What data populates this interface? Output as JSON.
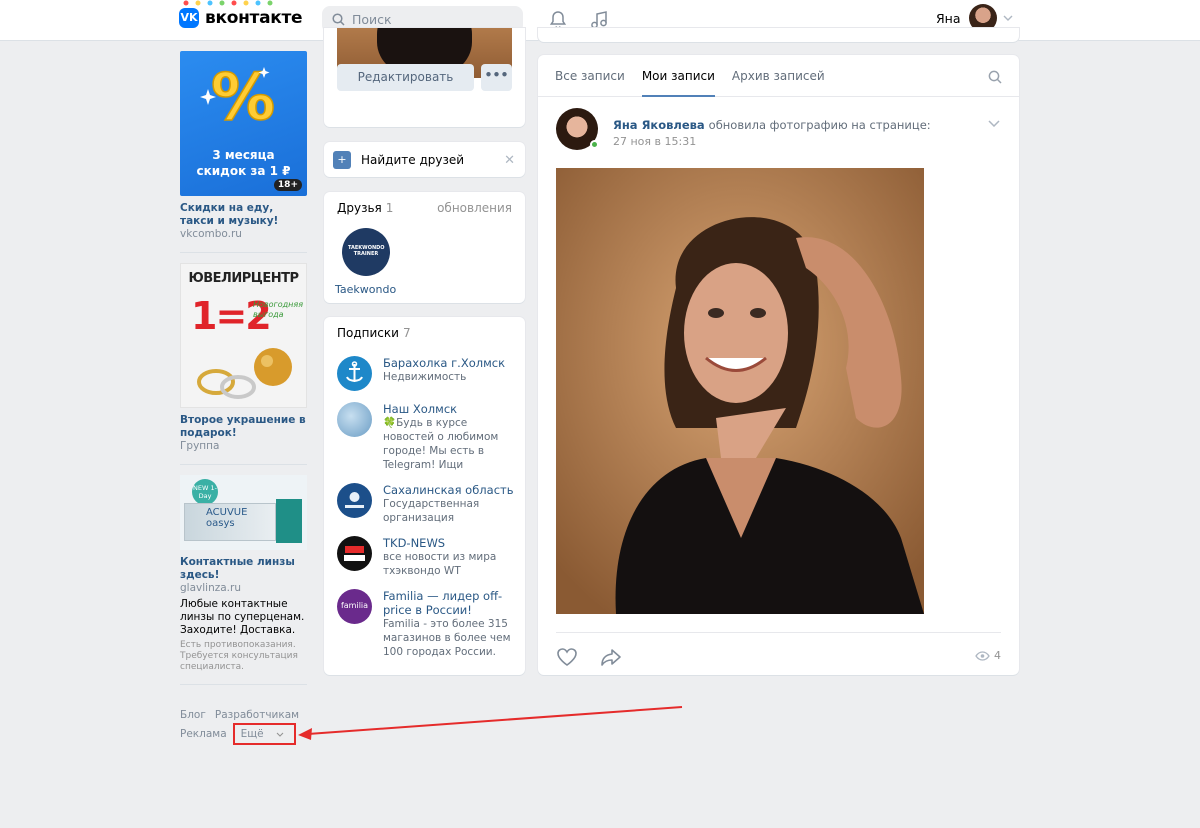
{
  "header": {
    "logo_text": "вконтакте",
    "search_placeholder": "Поиск",
    "user_name": "Яна"
  },
  "left_ads": [
    {
      "badge": "18+",
      "banner_text": "3 месяца скидок за 1 ₽",
      "title": "Скидки на еду, такси и музыку!",
      "sub": "vkcombo.ru"
    },
    {
      "banner_text_top": "ЮВЕЛИРЦЕНТР",
      "banner_text_mid": "1=2",
      "banner_text_script": "Новогодняя выгода",
      "title": "Второе украшение в подарок!",
      "sub": "Группа"
    },
    {
      "banner_text_brand": "ACUVUE oasys",
      "banner_text_badge": "NEW 1-Day",
      "title": "Контактные линзы здесь!",
      "sub": "glavlinza.ru",
      "desc": "Любые контактные линзы по суперценам. Заходите! Доставка.",
      "note": "Есть противопоказания. Требуется консультация специалиста."
    }
  ],
  "footer": {
    "links": [
      "Блог",
      "Разработчикам",
      "Реклама"
    ],
    "more": "Ещё"
  },
  "profile": {
    "edit_button": "Редактировать",
    "more_button": "•••"
  },
  "find_friends": {
    "label": "Найдите друзей"
  },
  "friends": {
    "title": "Друзья",
    "count": "1",
    "updates": "обновления",
    "items": [
      {
        "name": "Taekwondo",
        "logo_text": "TAEKWONDO TRAINER"
      }
    ]
  },
  "subscriptions": {
    "title": "Подписки",
    "count": "7",
    "items": [
      {
        "name": "Барахолка г.Холмск",
        "desc": "Недвижимость",
        "color": "#1e88c9"
      },
      {
        "name": "Наш Холмск",
        "desc": "🍀Будь в курсе новостей о любимом городе! Мы есть в Telegram! Ищи",
        "color": "#8ab6d6"
      },
      {
        "name": "Сахалинская область",
        "desc": "Государственная организация",
        "color": "#1c4f8a"
      },
      {
        "name": "TKD-NEWS",
        "desc": "все новости из мира тхэквондо WT",
        "color": "#111111"
      },
      {
        "name": "Familia — лидер off-price в России!",
        "desc": "Familia - это более 315 магазинов в более чем 100 городах России.",
        "color": "#6a2a8c",
        "logo_text": "familia"
      }
    ]
  },
  "wall": {
    "tabs": [
      "Все записи",
      "Мои записи",
      "Архив записей"
    ],
    "active_tab": 1
  },
  "post": {
    "author": "Яна Яковлева",
    "action": "обновила фотографию на странице:",
    "date": "27 ноя в 15:31",
    "views": "4"
  }
}
